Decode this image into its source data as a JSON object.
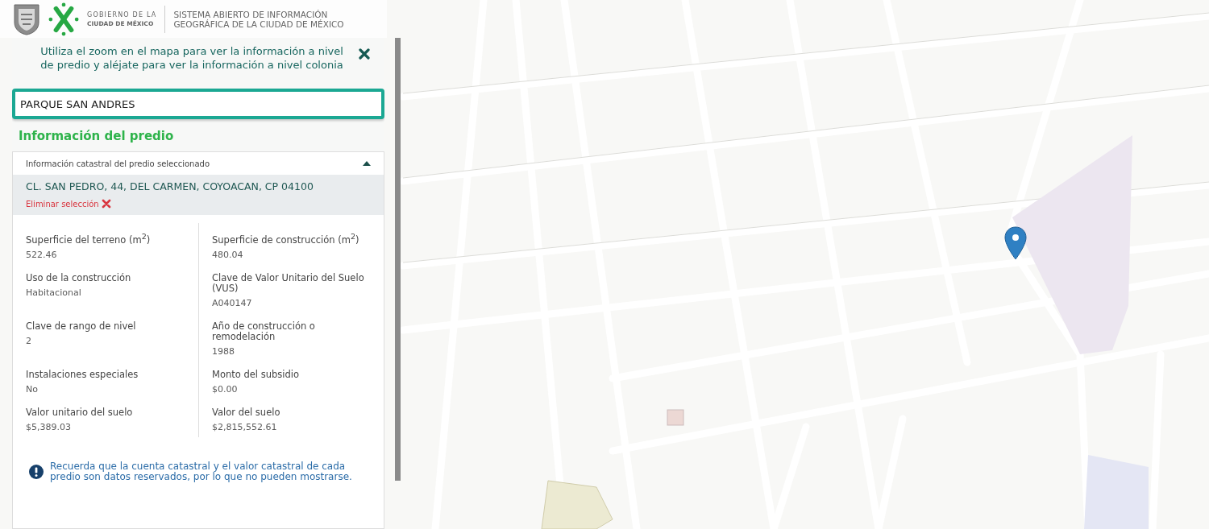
{
  "header": {
    "brand_line_1": "GOBIERNO DE LA",
    "brand_line_2": "CIUDAD DE MÉXICO",
    "title_line_1": "SISTEMA ABIERTO DE INFORMACIÓN",
    "title_line_2": "GEOGRÁFICA DE LA CIUDAD DE MÉXICO"
  },
  "hint": {
    "text": "Utiliza el zoom en el mapa para ver la información a nivel de predio y aléjate para ver la información a nivel colonia"
  },
  "search": {
    "value": "PARQUE SAN ANDRES"
  },
  "section_title": "Información del predio",
  "accordion": {
    "title": "Información catastral del predio seleccionado",
    "expanded": true,
    "address": "CL. SAN PEDRO, 44, DEL CARMEN, COYOACAN, CP 04100",
    "clear_label": "Eliminar selección",
    "fields": [
      {
        "label": "Superficie del terreno (m$^{2}$)",
        "value": "522.46"
      },
      {
        "label": "Superficie de construcción (m$^{2}$)",
        "value": "480.04"
      },
      {
        "label": "Uso de la construcción",
        "value": "Habitacional"
      },
      {
        "label": "Clave de Valor Unitario del Suelo (VUS)",
        "value": "A040147"
      },
      {
        "label": "Clave de rango de nivel",
        "value": "2"
      },
      {
        "label": "Año de construcción o remodelación",
        "value": "1988"
      },
      {
        "label": "Instalaciones especiales",
        "value": "No"
      },
      {
        "label": "Monto del subsidio",
        "value": "$0.00"
      },
      {
        "label": "Valor unitario del suelo",
        "value": "$5,389.03"
      },
      {
        "label": "Valor del suelo",
        "value": "$2,815,552.61"
      }
    ],
    "notice": "Recuerda que la cuenta catastral y el valor catastral de cada predio son datos reservados, por lo que no pueden mostrarse."
  }
}
